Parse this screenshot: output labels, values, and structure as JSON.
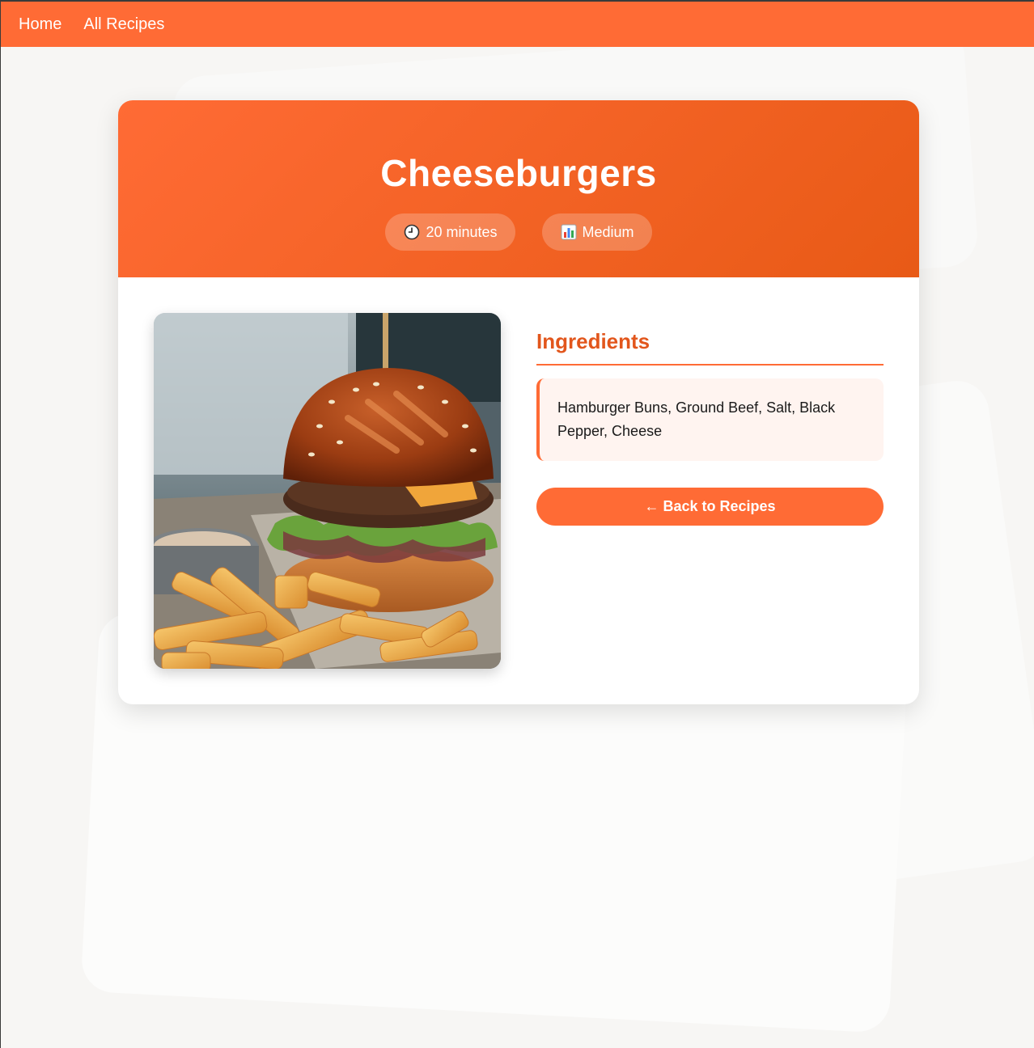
{
  "nav": {
    "links": [
      {
        "label": "Home"
      },
      {
        "label": "All Recipes"
      }
    ]
  },
  "recipe": {
    "title": "Cheeseburgers",
    "time": "20 minutes",
    "difficulty": "Medium",
    "time_icon": "clock-icon",
    "difficulty_icon": "bar-chart-icon",
    "ingredients_heading": "Ingredients",
    "ingredients": "Hamburger Buns, Ground Beef, Salt, Black Pepper, Cheese",
    "back_label": "← Back to Recipes"
  },
  "colors": {
    "accent": "#ff6b35",
    "accent_dark": "#e2561c",
    "ingredients_bg": "#fff4f0"
  }
}
